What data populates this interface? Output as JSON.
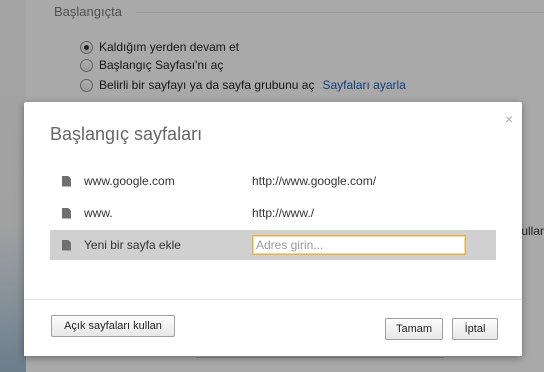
{
  "background": {
    "section_title": "Başlangıçta",
    "options": [
      {
        "label": "Kaldığım yerden devam et",
        "checked": true
      },
      {
        "label": "Başlangıç Sayfası'nı aç",
        "checked": false
      },
      {
        "label": "Belirli bir sayfayı ya da sayfa grubunu aç",
        "checked": false
      }
    ],
    "set_pages_link": "Sayfaları ayarla",
    "side_text": "ullar"
  },
  "dialog": {
    "title": "Başlangıç sayfaları",
    "close_symbol": "×",
    "pages": [
      {
        "title": "www.google.com",
        "url": "http://www.google.com/"
      },
      {
        "title": "www.",
        "url": "http://www./"
      }
    ],
    "new_page": {
      "label": "Yeni bir sayfa ekle",
      "placeholder": "Adres girin...",
      "value": ""
    },
    "buttons": {
      "use_open_pages": "Açık sayfaları kullan",
      "ok": "Tamam",
      "cancel": "İptal"
    }
  },
  "colors": {
    "link": "#1b5fb9",
    "input_focus": "#e6b24a",
    "selected_row": "#d0d0d0"
  }
}
